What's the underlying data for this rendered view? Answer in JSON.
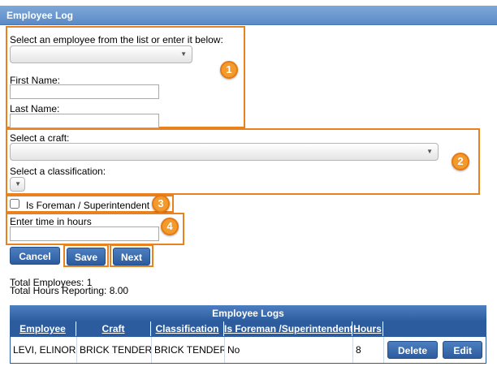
{
  "window": {
    "title": "Employee Log"
  },
  "form": {
    "employee_select_label": "Select an employee from the list or enter it below:",
    "employee_select_value": "",
    "first_name_label": "First Name:",
    "first_name_value": "",
    "last_name_label": "Last Name:",
    "last_name_value": "",
    "craft_label": "Select a craft:",
    "craft_value": "",
    "classification_label": "Select a classification:",
    "classification_value": "",
    "foreman_label": "Is Foreman / Superintendent",
    "foreman_checked": false,
    "hours_label": "Enter time in hours",
    "hours_value": ""
  },
  "buttons": {
    "cancel": "Cancel",
    "save": "Save",
    "next": "Next"
  },
  "callouts": [
    "1",
    "2",
    "3",
    "4"
  ],
  "totals": {
    "employees": "Total Employees: 1",
    "hours": "Total Hours Reporting: 8.00"
  },
  "grid": {
    "title": "Employee Logs",
    "columns": [
      "Employee",
      "Craft",
      "Classification",
      "Is Foreman /Superintendent",
      "Hours",
      ""
    ],
    "rows": [
      {
        "employee": "LEVI, ELINOR",
        "craft": "BRICK TENDER",
        "classification": "BRICK TENDER",
        "foreman": "No",
        "hours": "8",
        "delete": "Delete",
        "edit": "Edit"
      }
    ]
  },
  "colors": {
    "accent": "#e8821e",
    "header_blue": "#2c5c9e",
    "title_blue": "#6b97cf"
  }
}
